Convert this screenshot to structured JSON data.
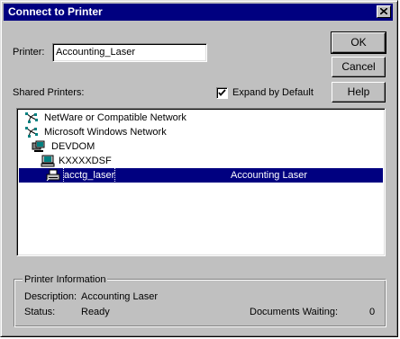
{
  "window": {
    "title": "Connect to Printer"
  },
  "printer_field": {
    "label": "Printer:",
    "value": "Accounting_Laser"
  },
  "buttons": {
    "ok": "OK",
    "cancel": "Cancel",
    "help": "Help"
  },
  "shared_printers_label": "Shared Printers:",
  "expand_by_default": {
    "label": "Expand by Default",
    "checked": true
  },
  "tree": {
    "items": [
      {
        "label": "NetWare or Compatible Network",
        "icon": "network-icon"
      },
      {
        "label": "Microsoft Windows Network",
        "icon": "network-icon"
      },
      {
        "label": "DEVDOM",
        "icon": "domain-icon"
      },
      {
        "label": "KXXXXDSF",
        "icon": "computer-icon"
      },
      {
        "label": "acctg_laser",
        "description": "Accounting Laser",
        "icon": "printer-icon",
        "selected": true
      }
    ]
  },
  "printer_info": {
    "legend": "Printer Information",
    "description_label": "Description:",
    "description_value": "Accounting Laser",
    "status_label": "Status:",
    "status_value": "Ready",
    "docs_waiting_label": "Documents Waiting:",
    "docs_waiting_value": "0"
  },
  "colors": {
    "title_bar": "#000080",
    "selection": "#000080",
    "face": "#c0c0c0"
  }
}
